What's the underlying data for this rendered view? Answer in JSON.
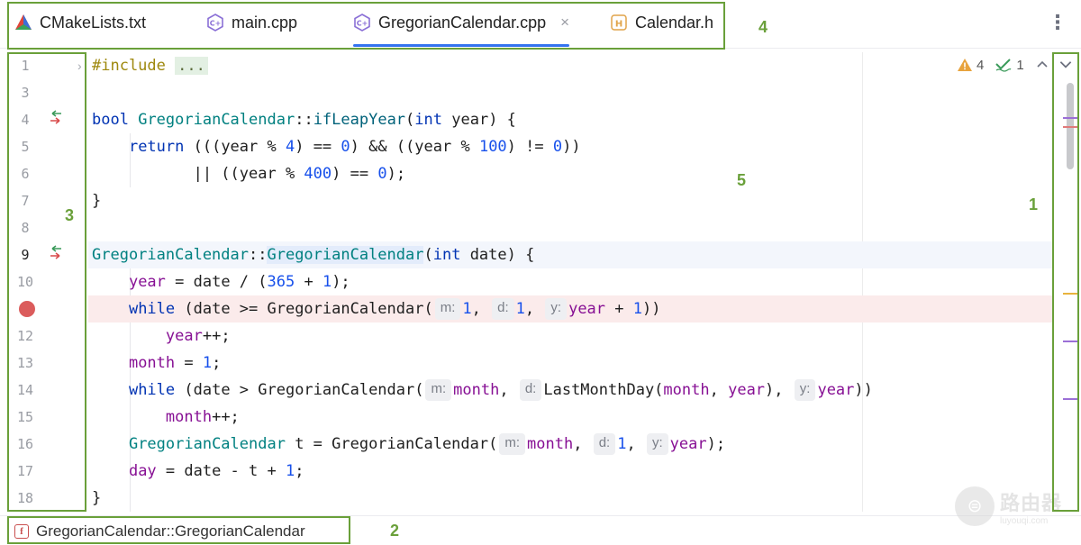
{
  "tabs": [
    {
      "label": "CMakeLists.txt",
      "icon": "cmake-icon",
      "active": false
    },
    {
      "label": "main.cpp",
      "icon": "cpp-file-icon",
      "active": false
    },
    {
      "label": "GregorianCalendar.cpp",
      "icon": "cpp-file-icon",
      "active": true
    },
    {
      "label": "Calendar.h",
      "icon": "header-file-icon",
      "active": false
    }
  ],
  "tab_close_glyph": "×",
  "tabs_menu_glyph": "⋮",
  "annotations": {
    "a1": "1",
    "a2": "2",
    "a3": "3",
    "a4": "4",
    "a5": "5"
  },
  "inspections": {
    "warnings": "4",
    "weak_warnings": "1"
  },
  "line_numbers": [
    "1",
    "3",
    "4",
    "5",
    "6",
    "7",
    "8",
    "9",
    "10",
    "12",
    "13",
    "14",
    "15",
    "16",
    "17",
    "18"
  ],
  "code": {
    "l1_directive": "#include",
    "l1_folded": "...",
    "l4_type": "bool",
    "l4_class": "GregorianCalendar",
    "l4_sep": "::",
    "l4_fn": "ifLeapYear",
    "l4_open": "(",
    "l4_ptype": "int",
    "l4_rest": " year) {",
    "l5_kw": "return",
    "l5_a": " (((year % ",
    "l5_n1": "4",
    "l5_b": ") == ",
    "l5_n2": "0",
    "l5_c": ") && ((year % ",
    "l5_n3": "100",
    "l5_d": ") != ",
    "l5_n4": "0",
    "l5_e": "))",
    "l6_a": "|| ((year % ",
    "l6_n1": "400",
    "l6_b": ") == ",
    "l6_n2": "0",
    "l6_c": ");",
    "l7": "}",
    "l9_class": "GregorianCalendar",
    "l9_sep": "::",
    "l9_ctor": "GregorianCalendar",
    "l9_open": "(",
    "l9_ptype": "int",
    "l9_rest": " date) {",
    "l10_field": "year",
    "l10_a": " = date / (",
    "l10_n1": "365",
    "l10_b": " + ",
    "l10_n2": "1",
    "l10_c": ");",
    "l11_kw": "while",
    "l11_a": " (date >= GregorianCalendar(",
    "l11_h1": "m:",
    "l11_n1": "1",
    "l11_c1": ",",
    "l11_h2": "d:",
    "l11_n2": "1",
    "l11_c2": ",",
    "l11_h3": "y:",
    "l11_field": "year",
    "l11_b": " + ",
    "l11_n3": "1",
    "l11_c": "))",
    "l12_field": "year",
    "l12_a": "++;",
    "l13_field": "month",
    "l13_a": " = ",
    "l13_n1": "1",
    "l13_b": ";",
    "l14_kw": "while",
    "l14_a": " (date > GregorianCalendar(",
    "l14_h1": "m:",
    "l14_f1": "month",
    "l14_c1": ",",
    "l14_h2": "d:",
    "l14_b": "LastMonthDay(",
    "l14_f2": "month",
    "l14_c2": ", ",
    "l14_f3": "year",
    "l14_c3": "),",
    "l14_h3": "y:",
    "l14_f4": "year",
    "l14_c": "))",
    "l15_field": "month",
    "l15_a": "++;",
    "l16_class": "GregorianCalendar",
    "l16_a": " t = GregorianCalendar(",
    "l16_h1": "m:",
    "l16_f1": "month",
    "l16_c1": ",",
    "l16_h2": "d:",
    "l16_n1": "1",
    "l16_c2": ",",
    "l16_h3": "y:",
    "l16_f2": "year",
    "l16_b": ");",
    "l17_field": "day",
    "l17_a": " = date - t + ",
    "l17_n1": "1",
    "l17_b": ";",
    "l18": "}"
  },
  "breadcrumb": {
    "icon_letter": "f",
    "label": "GregorianCalendar::GregorianCalendar"
  },
  "watermark": {
    "logo_glyph": "⊜",
    "main": "路由器",
    "sub": "luyouqi.com"
  },
  "colors": {
    "accent": "#3574f0",
    "annotation": "#6aa03a",
    "breakpoint": "#db5c5c",
    "keyword": "#0033b3",
    "number": "#1750eb",
    "field": "#871094"
  }
}
